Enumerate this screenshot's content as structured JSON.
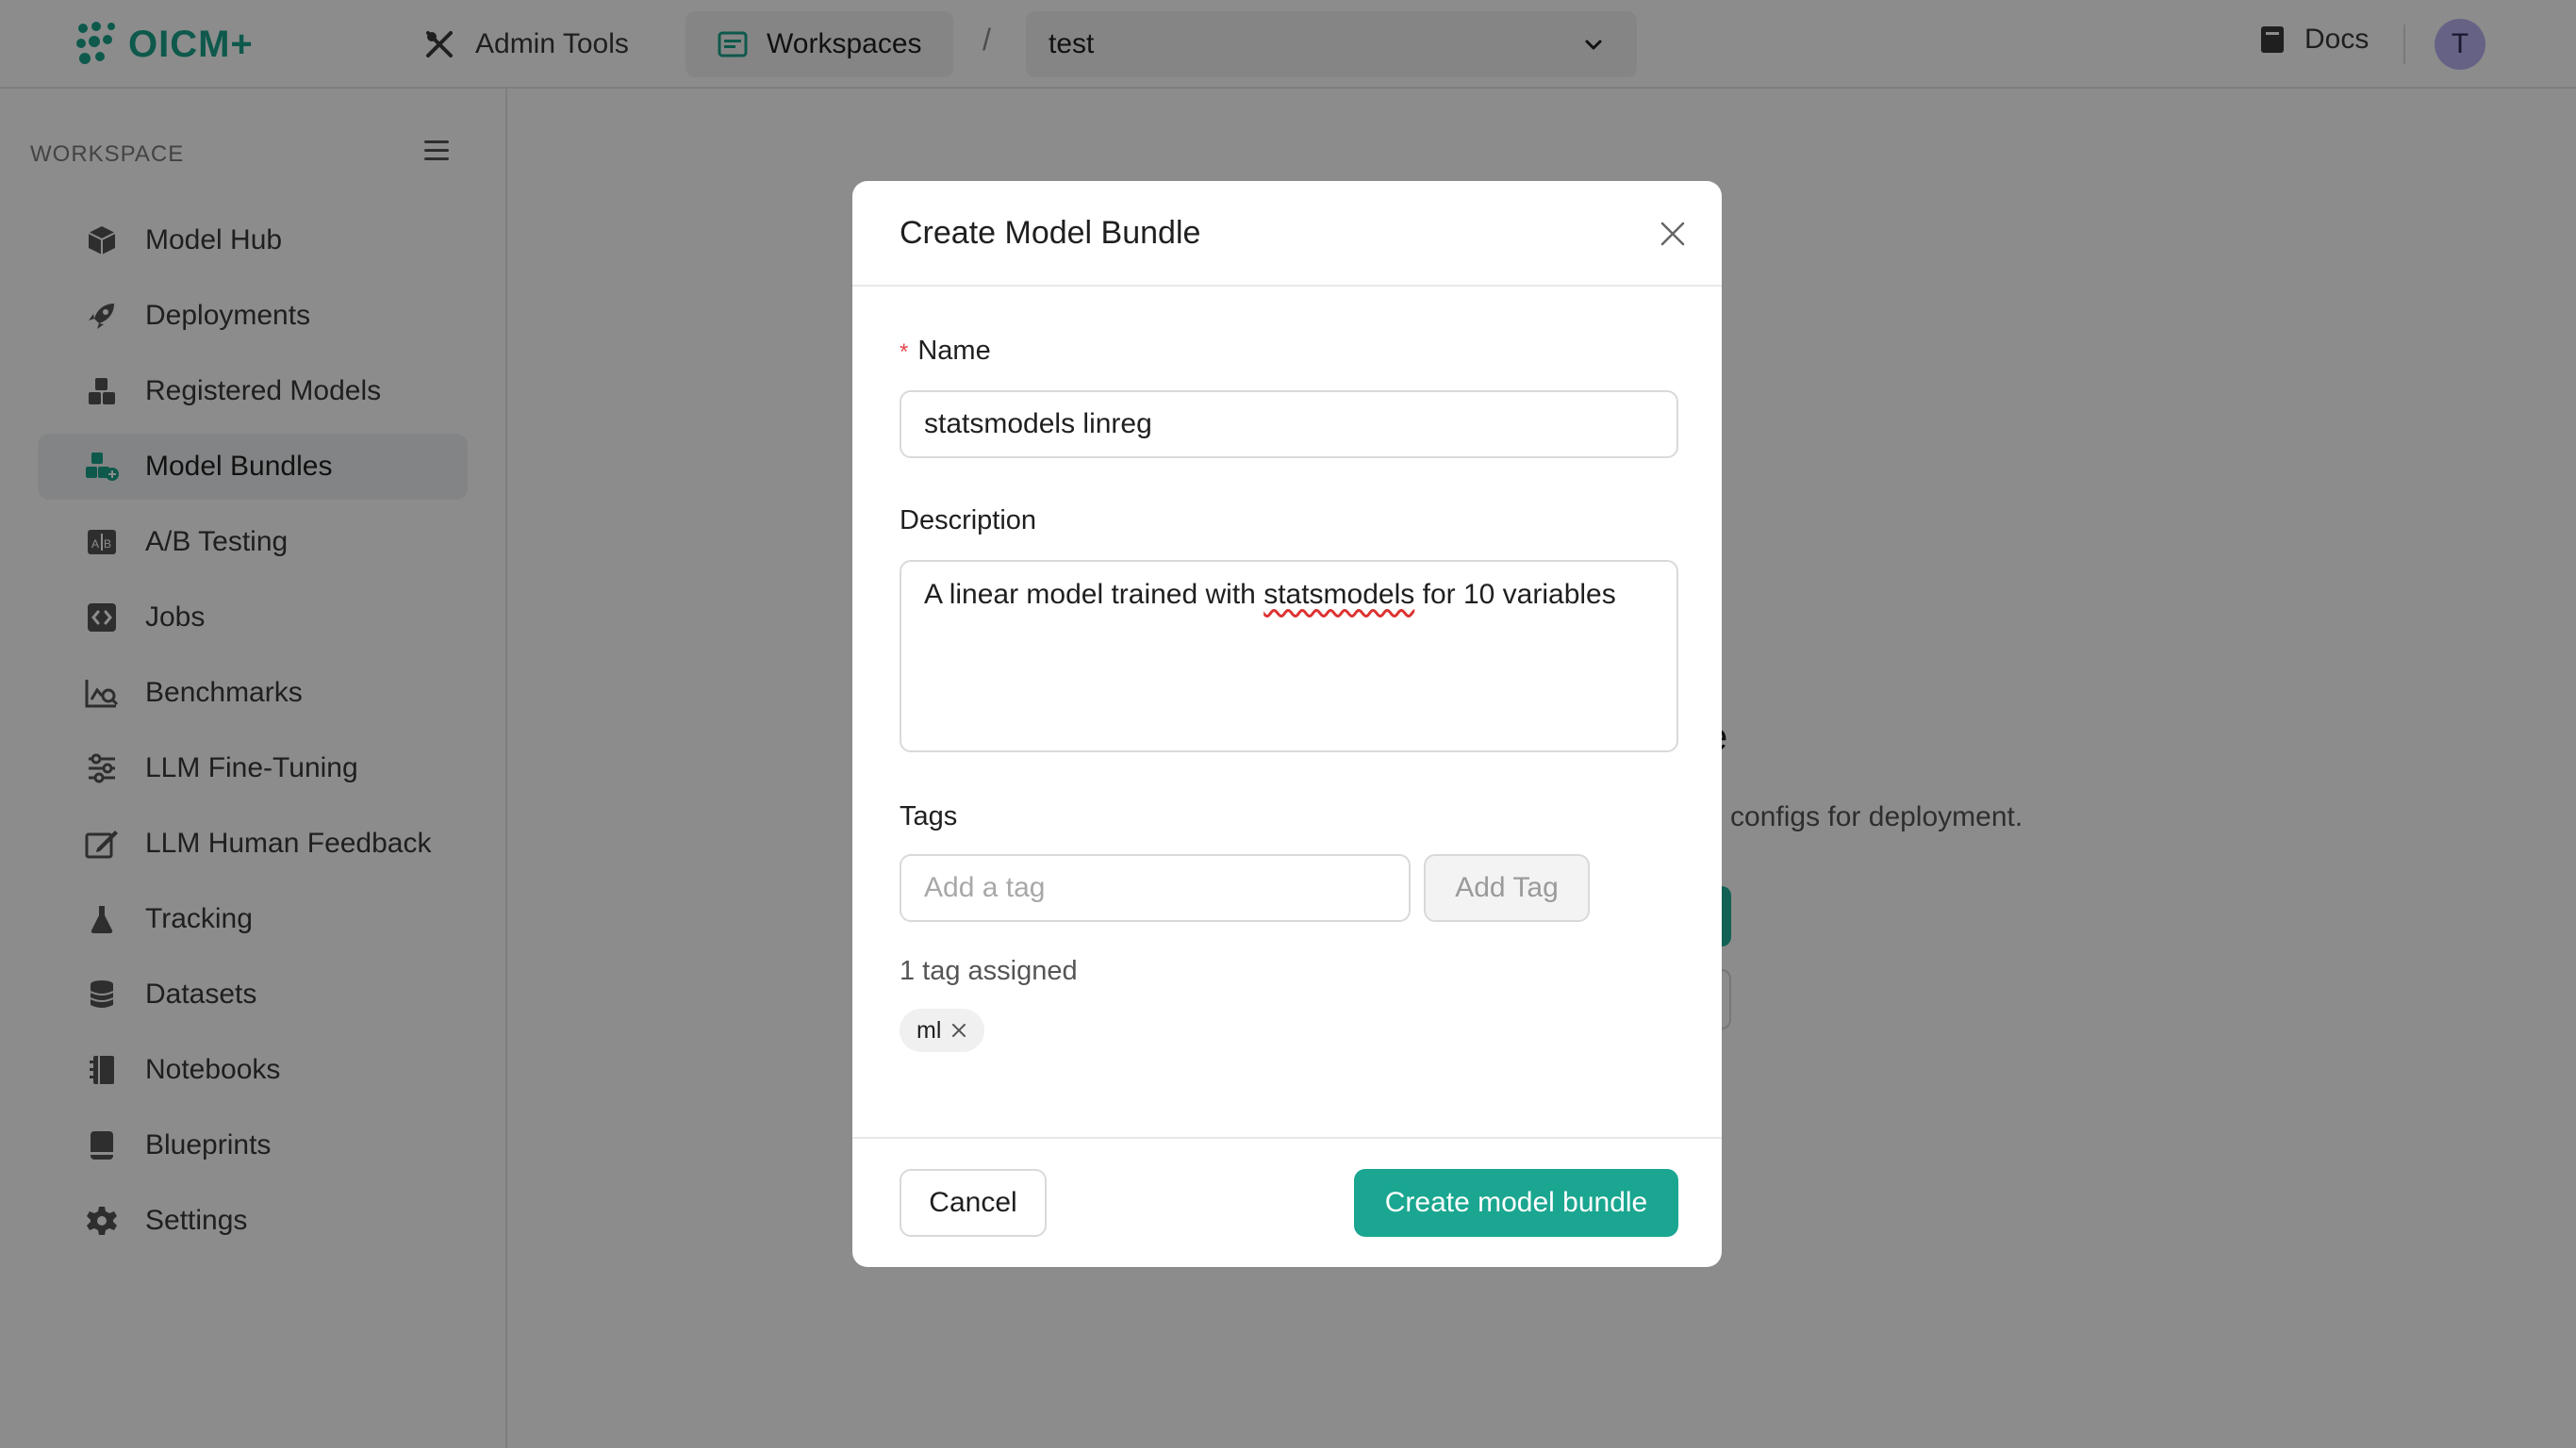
{
  "app": {
    "logo_text": "OICM+",
    "colors": {
      "brand": "#1aa38a",
      "primary_button": "#1aa690",
      "avatar_bg": "#b9b3f3",
      "required": "#e5484d"
    }
  },
  "topbar": {
    "admin_tools": "Admin Tools",
    "workspaces": "Workspaces",
    "separator": "/",
    "workspace_selected": "test",
    "docs": "Docs",
    "avatar_initial": "T"
  },
  "sidebar": {
    "header": "WORKSPACE",
    "items": [
      {
        "label": "Model Hub",
        "icon": "cube-icon"
      },
      {
        "label": "Deployments",
        "icon": "rocket-icon"
      },
      {
        "label": "Registered Models",
        "icon": "cubes-icon"
      },
      {
        "label": "Model Bundles",
        "icon": "cubes-plus-icon",
        "active": true
      },
      {
        "label": "A/B Testing",
        "icon": "ab-icon"
      },
      {
        "label": "Jobs",
        "icon": "code-icon"
      },
      {
        "label": "Benchmarks",
        "icon": "chart-search-icon"
      },
      {
        "label": "LLM Fine-Tuning",
        "icon": "sliders-icon"
      },
      {
        "label": "LLM Human Feedback",
        "icon": "edit-icon"
      },
      {
        "label": "Tracking",
        "icon": "flask-icon"
      },
      {
        "label": "Datasets",
        "icon": "database-icon"
      },
      {
        "label": "Notebooks",
        "icon": "notebook-icon"
      },
      {
        "label": "Blueprints",
        "icon": "book-icon"
      },
      {
        "label": "Settings",
        "icon": "gear-icon"
      }
    ]
  },
  "background": {
    "title_fragment": "e",
    "subtitle_fragment": "d configs for deployment."
  },
  "modal": {
    "title": "Create Model Bundle",
    "name_required_mark": "*",
    "name_label": "Name",
    "name_value": "statsmodels linreg",
    "description_label": "Description",
    "description_before": "A linear model trained with ",
    "description_misspelled": "statsmodels",
    "description_after": " for 10 variables",
    "tags_label": "Tags",
    "tag_placeholder": "Add a tag",
    "add_tag_button": "Add Tag",
    "tag_count": "1 tag assigned",
    "tags": [
      "ml"
    ],
    "cancel_button": "Cancel",
    "create_button": "Create model bundle"
  }
}
